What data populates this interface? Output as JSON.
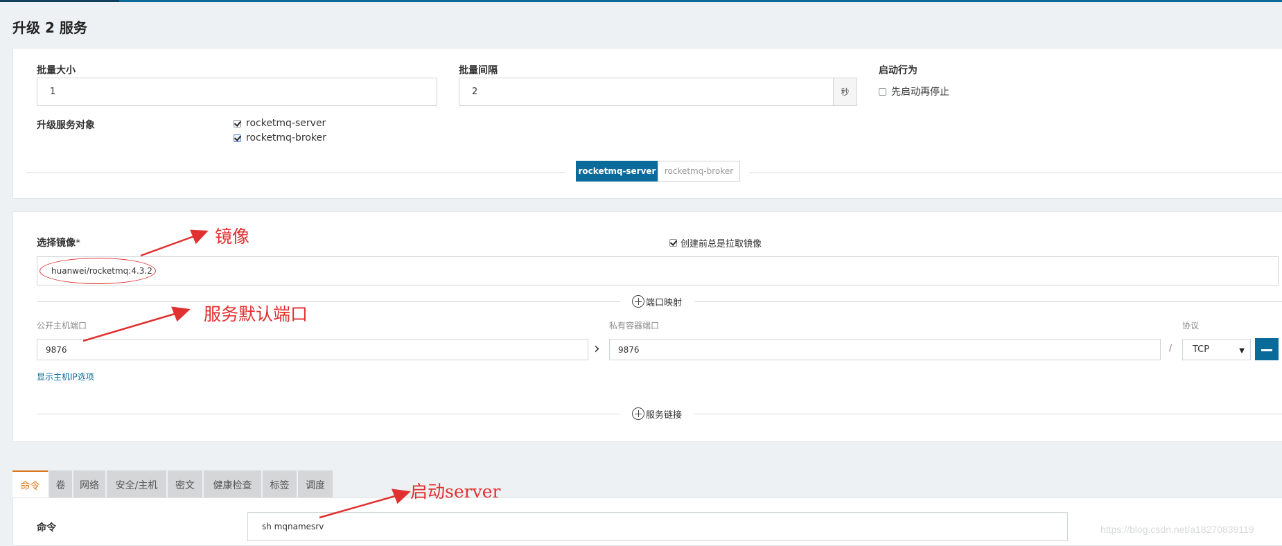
{
  "page": {
    "title": "升级 2 服务"
  },
  "batch": {
    "size_label": "批量大小",
    "size_value": "1",
    "interval_label": "批量间隔",
    "interval_value": "2",
    "interval_unit": "秒",
    "startup_label": "启动行为",
    "startup_option": "先启动再停止",
    "startup_checked": false
  },
  "targets": {
    "label": "升级服务对象",
    "items": [
      {
        "label": "rocketmq-server",
        "checked": true
      },
      {
        "label": "rocketmq-broker",
        "checked": true
      }
    ]
  },
  "service_tabs": [
    {
      "label": "rocketmq-server",
      "active": true
    },
    {
      "label": "rocketmq-broker",
      "active": false
    }
  ],
  "image": {
    "label": "选择镜像",
    "required_mark": "*",
    "value": "huanwei/rocketmq:4.3.2",
    "pull_label": "创建前总是拉取镜像",
    "pull_checked": true
  },
  "ports": {
    "section_label": "端口映射",
    "public_label": "公开主机端口",
    "private_label": "私有容器端口",
    "protocol_label": "协议",
    "public_value": "9876",
    "private_value": "9876",
    "arrow": "›",
    "separator": "/",
    "protocol_value": "TCP",
    "show_ip_link": "显示主机IP选项"
  },
  "links": {
    "section_label": "服务链接"
  },
  "config_tabs": [
    "命令",
    "卷",
    "网络",
    "安全/主机",
    "密文",
    "健康检查",
    "标签",
    "调度"
  ],
  "command": {
    "label": "命令",
    "value": "sh mqnamesrv"
  },
  "annotations": {
    "image": "镜像",
    "port": "服务默认端口",
    "command": "启动server"
  },
  "watermark": "https://blog.csdn.net/a18270839119",
  "colors": {
    "primary": "#0a6a9a",
    "tab_active": "#d9751a",
    "annotation": "#e03030"
  }
}
